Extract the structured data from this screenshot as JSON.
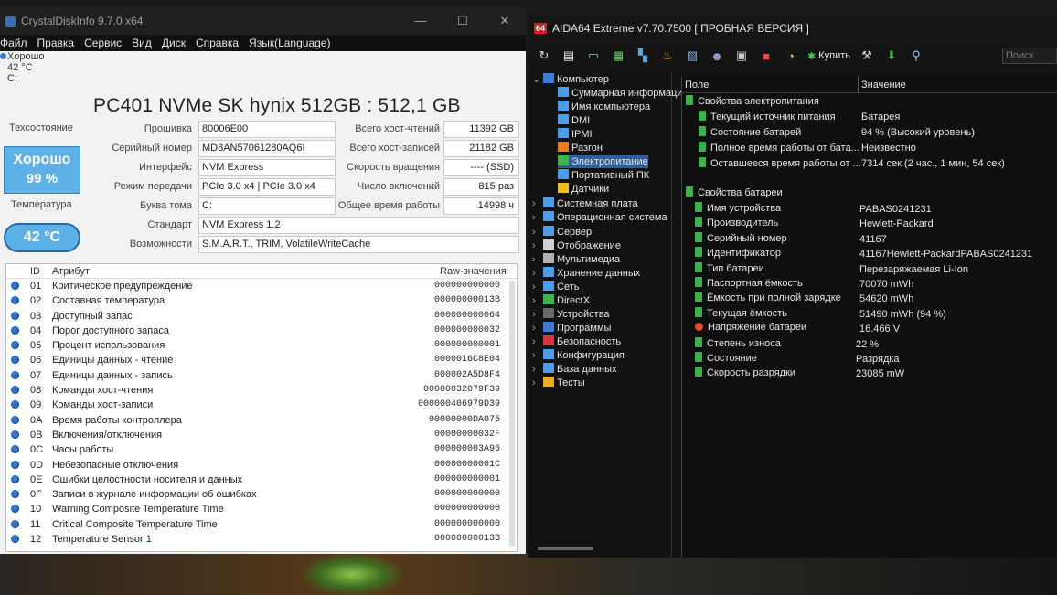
{
  "cdi": {
    "title": "CrystalDiskInfo 9.7.0 x64",
    "menu": [
      "Файл",
      "Правка",
      "Сервис",
      "Вид",
      "Диск",
      "Справка",
      "Язык(Language)"
    ],
    "mini_status": {
      "label": "Хорошо",
      "temp": "42 °C",
      "drive": "C:"
    },
    "disk_title": "PC401 NVMe SK hynix 512GB : 512,1 GB",
    "health_label": "Техсостояние",
    "health_status": "Хорошо",
    "health_percent": "99 %",
    "temp_label": "Температура",
    "temp_value": "42 °C",
    "left_fields": [
      {
        "label": "Прошивка",
        "value": "80006E00"
      },
      {
        "label": "Серийный номер",
        "value": "MD8AN57061280AQ6I"
      },
      {
        "label": "Интерфейс",
        "value": "NVM Express"
      },
      {
        "label": "Режим передачи",
        "value": "PCIe 3.0 x4 | PCIe 3.0 x4"
      },
      {
        "label": "Буква тома",
        "value": "C:"
      },
      {
        "label": "Стандарт",
        "value": "NVM Express 1.2"
      },
      {
        "label": "Возможности",
        "value": "S.M.A.R.T., TRIM, VolatileWriteCache"
      }
    ],
    "right_fields": [
      {
        "label": "Всего хост-чтений",
        "value": "11392 GB"
      },
      {
        "label": "Всего хост-записей",
        "value": "21182 GB"
      },
      {
        "label": "Скорость вращения",
        "value": "---- (SSD)"
      },
      {
        "label": "Число включений",
        "value": "815 раз"
      },
      {
        "label": "Общее время работы",
        "value": "14998 ч"
      }
    ],
    "attr_headers": {
      "id": "ID",
      "name": "Атрибут",
      "raw": "Raw-значения"
    },
    "attributes": [
      {
        "id": "01",
        "name": "Критическое предупреждение",
        "raw": "000000000000"
      },
      {
        "id": "02",
        "name": "Составная температура",
        "raw": "00000000013B"
      },
      {
        "id": "03",
        "name": "Доступный запас",
        "raw": "000000000064"
      },
      {
        "id": "04",
        "name": "Порог доступного запаса",
        "raw": "000000000032"
      },
      {
        "id": "05",
        "name": "Процент использования",
        "raw": "000000000001"
      },
      {
        "id": "06",
        "name": "Единицы данных - чтение",
        "raw": "0000016C8E04"
      },
      {
        "id": "07",
        "name": "Единицы данных - запись",
        "raw": "000002A5D8F4"
      },
      {
        "id": "08",
        "name": "Команды хост-чтения",
        "raw": "00000032079F39"
      },
      {
        "id": "09",
        "name": "Команды хост-записи",
        "raw": "000000406979D39"
      },
      {
        "id": "0A",
        "name": "Время работы контроллера",
        "raw": "00000000DA075"
      },
      {
        "id": "0B",
        "name": "Включения/отключения",
        "raw": "00000000032F"
      },
      {
        "id": "0C",
        "name": "Часы работы",
        "raw": "000000003A96"
      },
      {
        "id": "0D",
        "name": "Небезопасные отключения",
        "raw": "00000000001C"
      },
      {
        "id": "0E",
        "name": "Ошибки целостности носителя и данных",
        "raw": "000000000001"
      },
      {
        "id": "0F",
        "name": "Записи в журнале информации об ошибках",
        "raw": "000000000000"
      },
      {
        "id": "10",
        "name": "Warning Composite Temperature Time",
        "raw": "000000000000"
      },
      {
        "id": "11",
        "name": "Critical Composite Temperature Time",
        "raw": "000000000000"
      },
      {
        "id": "12",
        "name": "Temperature Sensor 1",
        "raw": "00000000013B"
      }
    ]
  },
  "aida": {
    "title": "AIDA64 Extreme v7.70.7500  [ ПРОБНАЯ ВЕРСИЯ ]",
    "logo": "64",
    "buy_label": "Купить",
    "search_placeholder": "Поиск",
    "tree": [
      {
        "label": "Компьютер",
        "expanded": true
      },
      {
        "label": "Суммарная информация"
      },
      {
        "label": "Имя компьютера"
      },
      {
        "label": "DMI"
      },
      {
        "label": "IPMI"
      },
      {
        "label": "Разгон"
      },
      {
        "label": "Электропитание",
        "selected": true
      },
      {
        "label": "Портативный ПК"
      },
      {
        "label": "Датчики"
      },
      {
        "label": "Системная плата"
      },
      {
        "label": "Операционная система"
      },
      {
        "label": "Сервер"
      },
      {
        "label": "Отображение"
      },
      {
        "label": "Мультимедиа"
      },
      {
        "label": "Хранение данных"
      },
      {
        "label": "Сеть"
      },
      {
        "label": "DirectX"
      },
      {
        "label": "Устройства"
      },
      {
        "label": "Программы"
      },
      {
        "label": "Безопасность"
      },
      {
        "label": "Конфигурация"
      },
      {
        "label": "База данных"
      },
      {
        "label": "Тесты"
      }
    ],
    "col_field": "Поле",
    "col_value": "Значение",
    "group1": "Свойства электропитания",
    "power_props": [
      {
        "field": "Текущий источник питания",
        "value": "Батарея"
      },
      {
        "field": "Состояние батарей",
        "value": "94 % (Высокий уровень)"
      },
      {
        "field": "Полное время работы от бата...",
        "value": "Неизвестно"
      },
      {
        "field": "Оставшееся время работы от ...",
        "value": "7314 сек (2 час., 1 мин, 54 сек)"
      }
    ],
    "group2": "Свойства батареи",
    "battery_props": [
      {
        "field": "Имя устройства",
        "value": "PABAS0241231"
      },
      {
        "field": "Производитель",
        "value": "Hewlett-Packard"
      },
      {
        "field": "Серийный номер",
        "value": "41167"
      },
      {
        "field": "Идентификатор",
        "value": "41167Hewlett-PackardPABAS0241231"
      },
      {
        "field": "Тип батареи",
        "value": "Перезаряжаемая Li-Ion"
      },
      {
        "field": "Паспортная ёмкость",
        "value": "70070 mWh"
      },
      {
        "field": "Ёмкость при полной зарядке",
        "value": "54620 mWh"
      },
      {
        "field": "Текущая ёмкость",
        "value": "51490 mWh  (94 %)"
      },
      {
        "field": "Напряжение батареи",
        "value": "16.466 V"
      },
      {
        "field": "Степень износа",
        "value": "22 %"
      },
      {
        "field": "Состояние",
        "value": "Разрядка"
      },
      {
        "field": "Скорость разрядки",
        "value": "23085 mW"
      }
    ]
  }
}
